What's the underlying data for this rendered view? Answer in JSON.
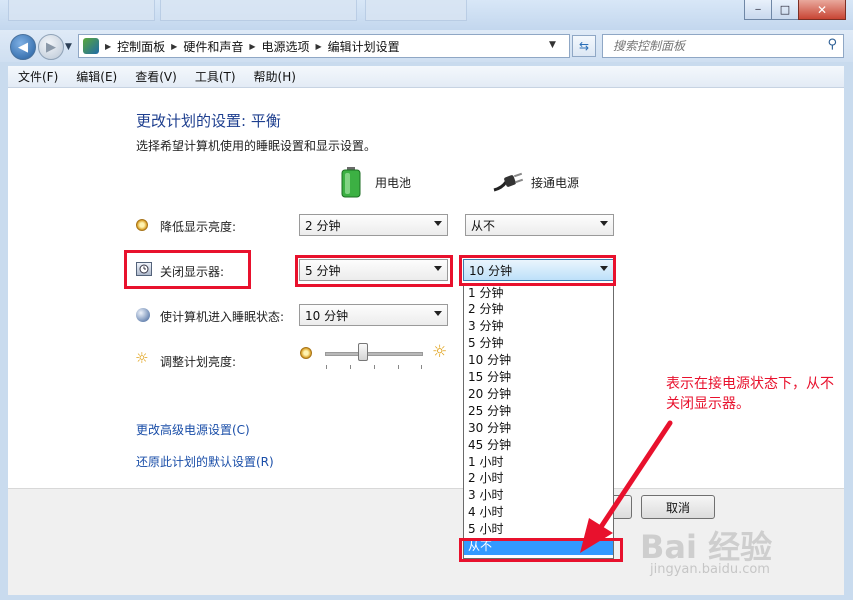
{
  "window": {
    "controls": {
      "minimize": "‒",
      "maximize": "□",
      "close": "✕"
    }
  },
  "nav": {
    "breadcrumb": [
      "控制面板",
      "硬件和声音",
      "电源选项",
      "编辑计划设置"
    ],
    "search_placeholder": "搜索控制面板"
  },
  "menu": [
    "文件(F)",
    "编辑(E)",
    "查看(V)",
    "工具(T)",
    "帮助(H)"
  ],
  "page": {
    "title": "更改计划的设置: 平衡",
    "subtitle": "选择希望计算机使用的睡眠设置和显示设置。",
    "col_battery": "用电池",
    "col_plugged": "接通电源"
  },
  "settings": [
    {
      "label": "降低显示亮度:",
      "battery": "2 分钟",
      "plugged": "从不"
    },
    {
      "label": "关闭显示器:",
      "battery": "5 分钟",
      "plugged": "10 分钟"
    },
    {
      "label": "使计算机进入睡眠状态:",
      "battery": "10 分钟"
    },
    {
      "label": "调整计划亮度:"
    }
  ],
  "brightness": {
    "battery_level": 0.4
  },
  "dropdown_options": [
    "1 分钟",
    "2 分钟",
    "3 分钟",
    "5 分钟",
    "10 分钟",
    "15 分钟",
    "20 分钟",
    "25 分钟",
    "30 分钟",
    "45 分钟",
    "1 小时",
    "2 小时",
    "3 小时",
    "4 小时",
    "5 小时",
    "从不"
  ],
  "dropdown_selected": "从不",
  "links": {
    "advanced": "更改高级电源设置(C)",
    "restore": "还原此计划的默认设置(R)"
  },
  "buttons": {
    "cancel": "取消"
  },
  "annotation": "表示在接电源状态下，从不关闭显示器。",
  "watermark": {
    "logo": "Bai 经验",
    "url": "jingyan.baidu.com"
  },
  "colors": {
    "annotation": "#e8112d",
    "selection": "#3399ff",
    "heading": "#1e3f8f",
    "link": "#1a4ea8"
  }
}
